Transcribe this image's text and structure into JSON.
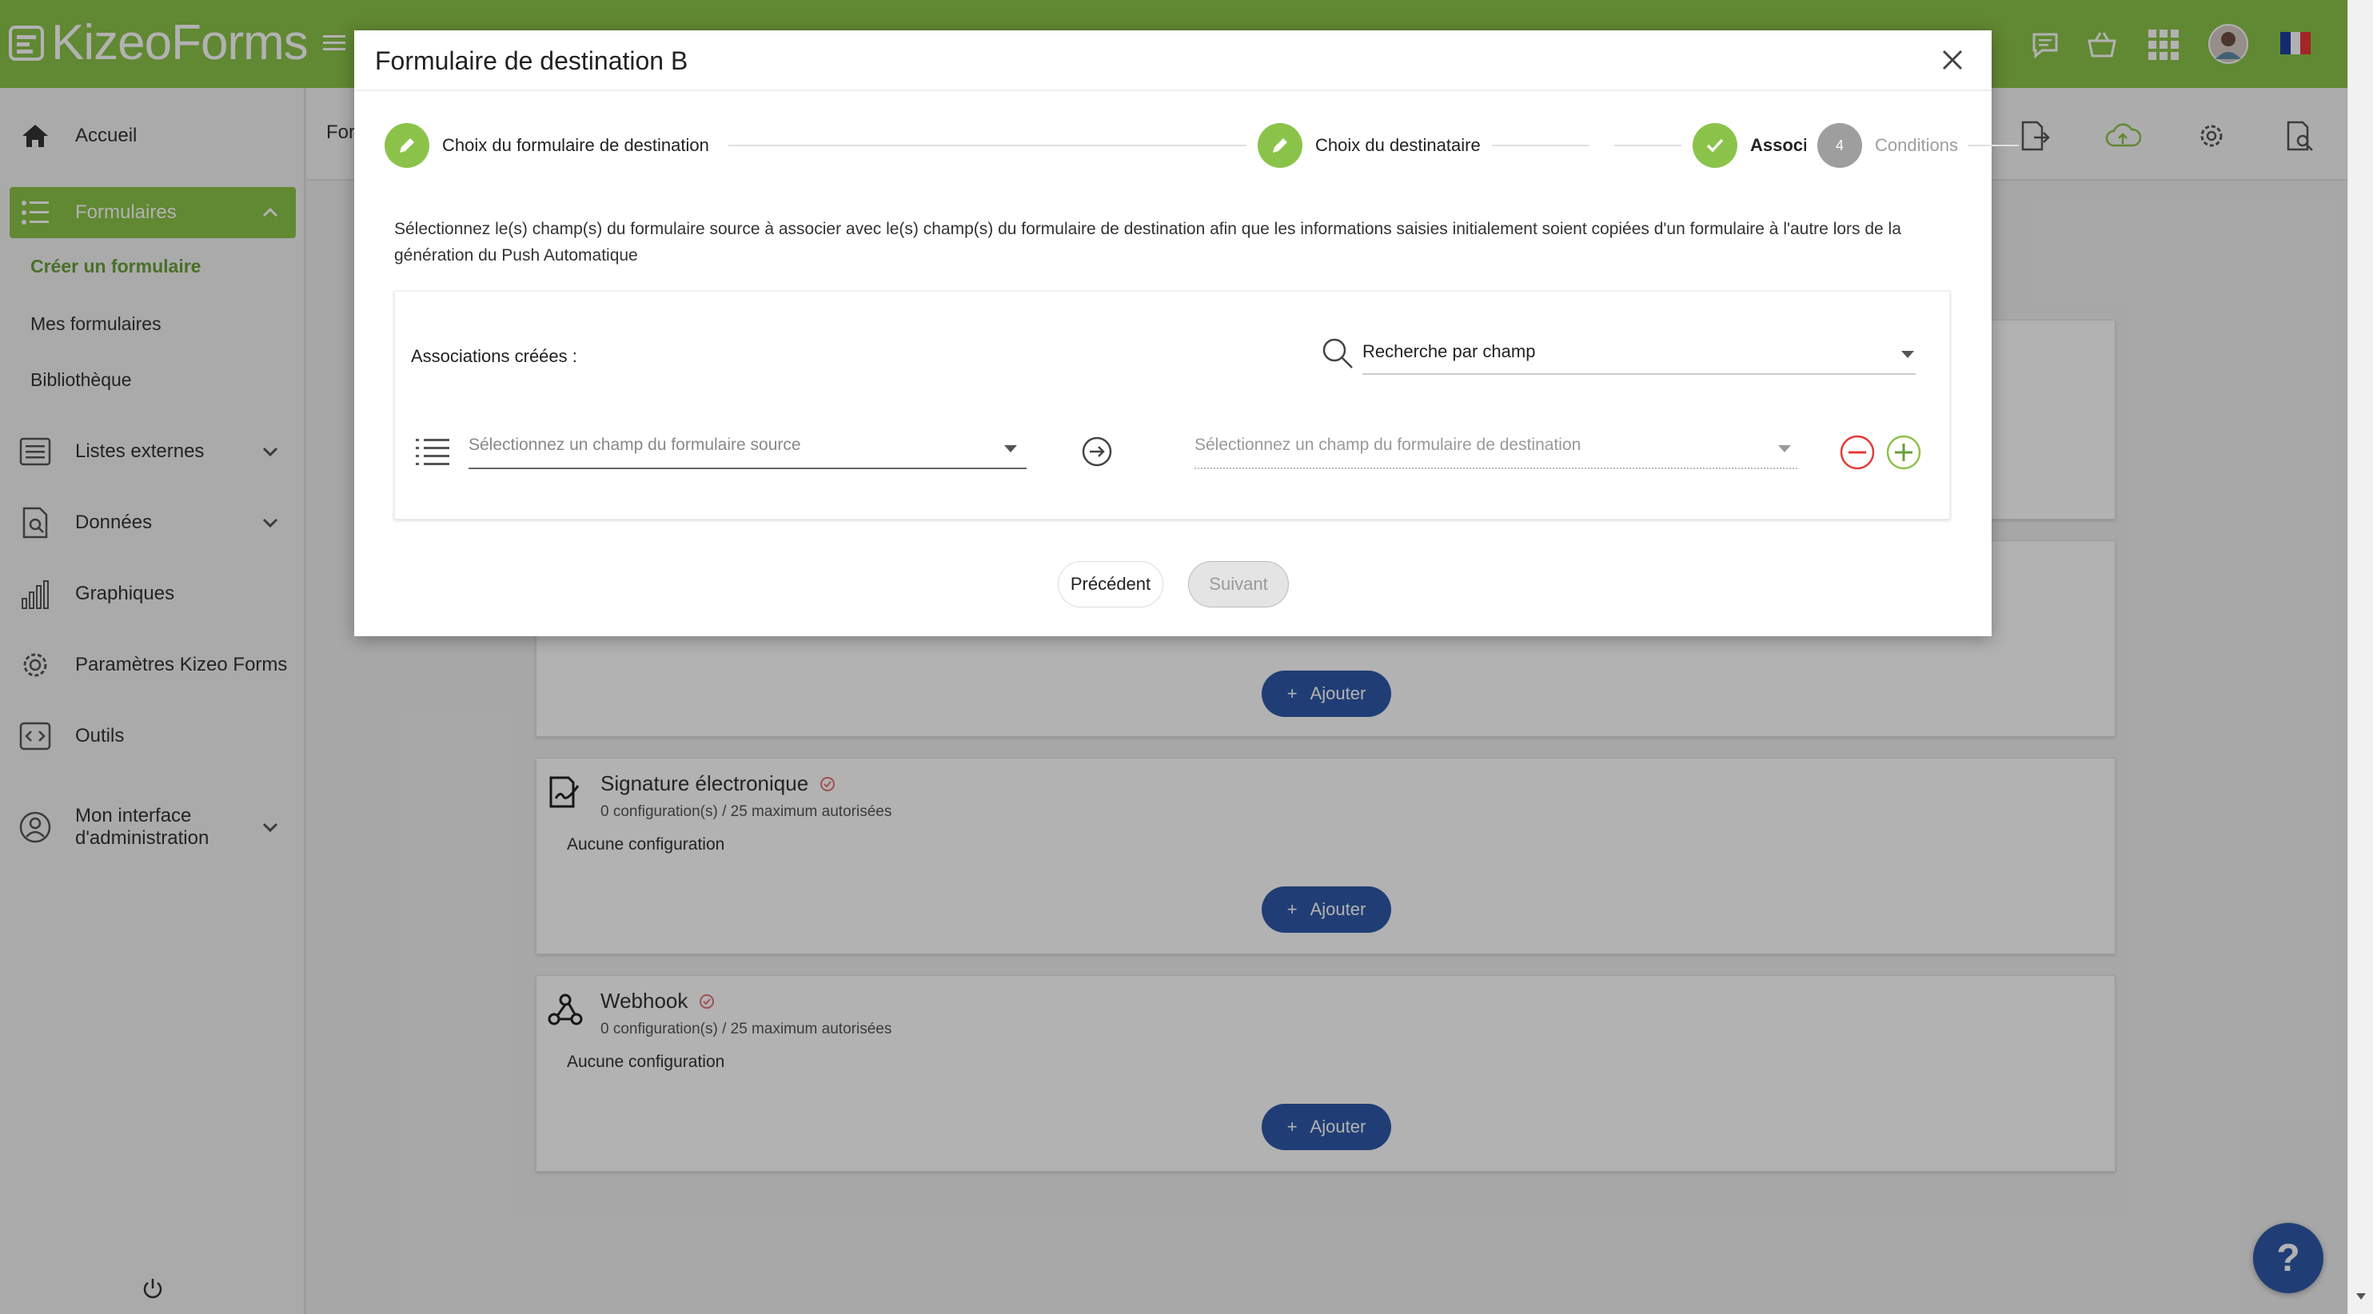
{
  "app": {
    "logo_text": "KizeoForms"
  },
  "sidebar": {
    "home": "Accueil",
    "forms": "Formulaires",
    "forms_sub": [
      "Créer un formulaire",
      "Mes formulaires",
      "Bibliothèque"
    ],
    "external_lists": "Listes externes",
    "data": "Données",
    "charts": "Graphiques",
    "settings": "Paramètres Kizeo Forms",
    "tools": "Outils",
    "admin": "Mon interface d'administration"
  },
  "background": {
    "tab_label_partial": "For",
    "cards": [
      {
        "title": "Signature électronique",
        "sub": "0 configuration(s) / 25 maximum autorisées",
        "none": "Aucune configuration"
      },
      {
        "title": "Webhook",
        "sub": "0 configuration(s) / 25 maximum autorisées",
        "none": "Aucune configuration"
      }
    ],
    "add_label": "Ajouter"
  },
  "modal": {
    "title": "Formulaire de destination B",
    "steps": [
      {
        "label": "Choix du formulaire de destination",
        "state": "done"
      },
      {
        "label": "Choix du destinataire",
        "state": "done"
      },
      {
        "label": "Association des champs",
        "state": "active"
      },
      {
        "label": "Conditions",
        "number": "4",
        "state": "pending"
      }
    ],
    "description": "Sélectionnez le(s) champ(s) du formulaire source à associer avec le(s) champ(s) du formulaire de destination afin que les informations saisies initialement soient copiées d'un formulaire à l'autre lors de la génération du Push Automatique",
    "associations_label": "Associations créées :",
    "search_value": "Recherche par champ",
    "source_placeholder": "Sélectionnez un champ du formulaire source",
    "destination_placeholder": "Sélectionnez un champ du formulaire de destination",
    "prev_label": "Précédent",
    "next_label": "Suivant"
  },
  "help_label": "?",
  "colors": {
    "brand_green": "#8bc34a",
    "primary_blue": "#2e5aa8",
    "danger_red": "#e53935"
  }
}
